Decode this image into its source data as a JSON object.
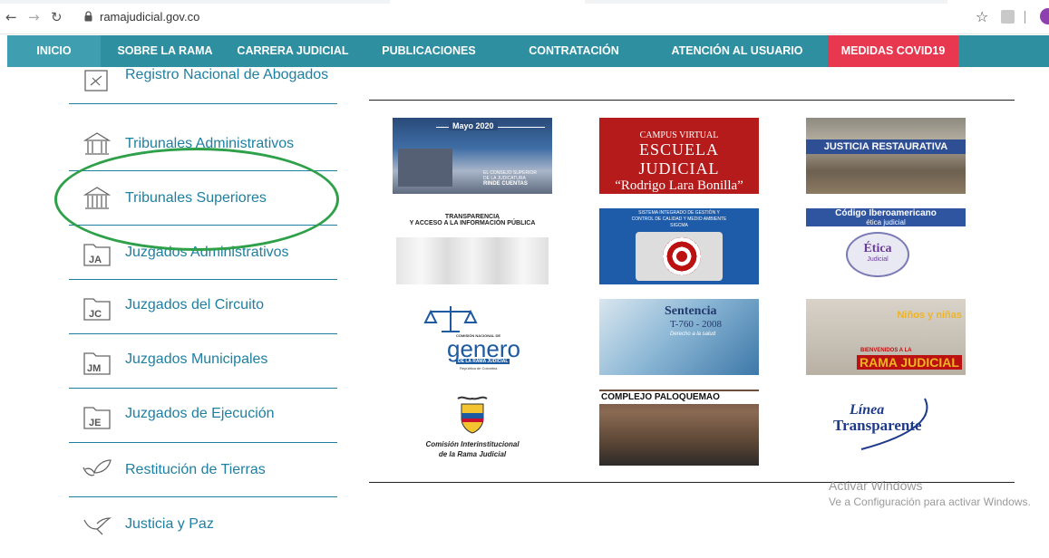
{
  "browser": {
    "url": "ramajudicial.gov.co"
  },
  "nav": {
    "items": [
      {
        "label": "INICIO"
      },
      {
        "label": "SOBRE LA RAMA"
      },
      {
        "label": "CARRERA JUDICIAL"
      },
      {
        "label": "PUBLICACIONES"
      },
      {
        "label": "CONTRATACIÓN"
      },
      {
        "label": "ATENCIÓN AL USUARIO"
      },
      {
        "label": "MEDIDAS COVID19"
      }
    ],
    "colors": {
      "bar": "#2e8fa1",
      "covid": "#e8384f"
    }
  },
  "menu": {
    "items": [
      {
        "label": "Registro Nacional de Abogados",
        "icon": "registry-icon"
      },
      {
        "label": "Tribunales Administrativos",
        "icon": "courthouse-icon"
      },
      {
        "label": "Tribunales Superiores",
        "icon": "courthouse-icon"
      },
      {
        "label": "Juzgados Administrativos",
        "icon": "folder-icon",
        "badge": "JA"
      },
      {
        "label": "Juzgados del Circuito",
        "icon": "folder-icon",
        "badge": "JC"
      },
      {
        "label": "Juzgados Municipales",
        "icon": "folder-icon",
        "badge": "JM"
      },
      {
        "label": "Juzgados de Ejecución",
        "icon": "folder-icon",
        "badge": "JE"
      },
      {
        "label": "Restitución de Tierras",
        "icon": "leaf-icon"
      },
      {
        "label": "Justicia y Paz",
        "icon": "dove-icon"
      }
    ]
  },
  "tiles": {
    "mayo": {
      "title": "Mayo 2020",
      "sub1": "EL CONSEJO SUPERIOR",
      "sub2": "DE LA JUDICATURA",
      "sub3": "RINDE CUENTAS"
    },
    "escuela": {
      "line1": "CAMPUS VIRTUAL",
      "line2": "ESCUELA JUDICIAL",
      "line3": "“Rodrigo Lara Bonilla”"
    },
    "restaurativa": {
      "title": "JUSTICIA RESTAURATIVA"
    },
    "transparencia": {
      "line1": "TRANSPARENCIA",
      "line2": "Y ACCESO A LA INFORMACIÓN PÚBLICA"
    },
    "sigcma": {
      "line1": "SISTEMA INTEGRADO DE GESTIÓN Y",
      "line2": "CONTROL DE CALIDAD Y MEDIO AMBIENTE",
      "line3": "SIGCMA"
    },
    "etica": {
      "line1": "Código Iberoamericano",
      "line2": "ética judicial",
      "badge1": "Ética",
      "badge2": "Judicial"
    },
    "genero": {
      "line1": "COMISIÓN NACIONAL DE",
      "word": "genero",
      "line3": "DE LA RAMA JUDICIAL",
      "line4": "República de Colombia"
    },
    "sentencia": {
      "line1": "Sentencia",
      "line2": "T-760 - 2008",
      "line3": "Derecho a la salud"
    },
    "ninos": {
      "line1": "Niños y niñas",
      "line2": "BIENVENIDOS A LA",
      "line3": "RAMA JUDICIAL"
    },
    "comision": {
      "line1": "Comisión Interinstitucional",
      "line2": "de la Rama Judicial"
    },
    "paloquemao": {
      "title": "COMPLEJO PALOQUEMAO"
    },
    "linea": {
      "line1": "Línea",
      "line2": "Transparente"
    }
  },
  "watermark": {
    "line1": "Activar Windows",
    "line2": "Ve a Configuración para activar Windows."
  }
}
